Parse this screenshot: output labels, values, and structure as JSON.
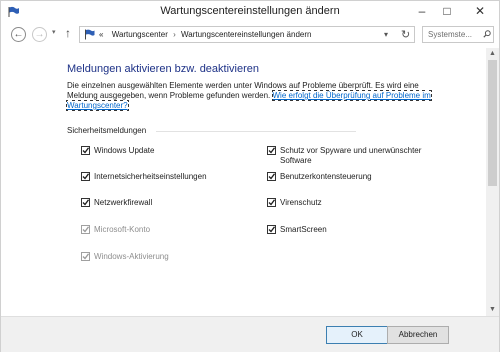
{
  "window": {
    "title": "Wartungscentereinstellungen ändern"
  },
  "titlebar_buttons": {
    "minimize": "–",
    "maximize": "□",
    "close": "✕"
  },
  "nav": {
    "back": "←",
    "forward": "→",
    "history": "▾",
    "up": "↑",
    "address": {
      "prefix": "«",
      "segments": [
        "Wartungscenter",
        "Wartungscentereinstellungen ändern"
      ],
      "separator": "›",
      "dropdown": "▾",
      "refresh": "↻"
    },
    "search": {
      "placeholder": "Systemste..."
    }
  },
  "content": {
    "heading": "Meldungen aktivieren bzw. deaktivieren",
    "description": "Die einzelnen ausgewählten Elemente werden unter Windows auf Probleme überprüft. Es wird eine Meldung ausgegeben, wenn Probleme gefunden werden.",
    "link": "Wie erfolgt die Überprüfung auf Probleme im Wartungscenter?",
    "section_title": "Sicherheitsmeldungen",
    "left_items": [
      {
        "label": "Windows Update",
        "checked": true,
        "disabled": false
      },
      {
        "label": "Internetsicherheitseinstellungen",
        "checked": true,
        "disabled": false
      },
      {
        "label": "Netzwerkfirewall",
        "checked": true,
        "disabled": false
      },
      {
        "label": "Microsoft-Konto",
        "checked": true,
        "disabled": true
      },
      {
        "label": "Windows-Aktivierung",
        "checked": true,
        "disabled": true
      }
    ],
    "right_items": [
      {
        "label": "Schutz vor Spyware und unerwünschter Software",
        "checked": true,
        "disabled": false
      },
      {
        "label": "Benutzerkontensteuerung",
        "checked": true,
        "disabled": false
      },
      {
        "label": "Virenschutz",
        "checked": true,
        "disabled": false
      },
      {
        "label": "SmartScreen",
        "checked": true,
        "disabled": false
      }
    ]
  },
  "scrollbar": {
    "up": "▲",
    "down": "▼"
  },
  "footer": {
    "ok": "OK",
    "cancel": "Abbrechen"
  },
  "colors": {
    "heading": "#1e3287",
    "link": "#0066cc",
    "footer_bg": "#f0f0f0"
  }
}
